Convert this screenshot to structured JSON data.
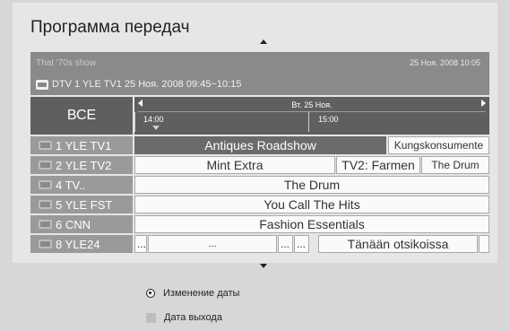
{
  "header": {
    "title": "Программа передач"
  },
  "info": {
    "show": "That '70s show",
    "datetime": "25 Ноя. 2008 10:05",
    "line": "DTV 1 YLE TV1 25 Ноя. 2008 09:45~10:15"
  },
  "timebar": {
    "all_label": "ВСЕ",
    "date": "Вт. 25 Ноя.",
    "time1": "14:00",
    "time2": "15:00"
  },
  "channels": [
    {
      "label": "1  YLE TV1"
    },
    {
      "label": "2  YLE TV2"
    },
    {
      "label": "4  TV.."
    },
    {
      "label": "5  YLE FST"
    },
    {
      "label": "6  CNN"
    },
    {
      "label": "8  YLE24"
    }
  ],
  "programs": {
    "r0": [
      "Antiques Roadshow",
      "Kungskonsumente"
    ],
    "r1": [
      "Mint Extra",
      "TV2: Farmen",
      "The Drum"
    ],
    "r2": [
      "The Drum"
    ],
    "r3": [
      "You Call The Hits"
    ],
    "r4": [
      "Fashion Essentials"
    ],
    "r5": [
      "...",
      "...",
      "...",
      "...",
      "Tänään otsikoissa",
      ""
    ]
  },
  "options": {
    "change_date": "Изменение даты",
    "release_date": "Дата выхода"
  },
  "icons": {
    "channel": "tv-icon",
    "dtv": "dtv-badge-icon"
  },
  "colors": {
    "selected": "#6b6b6b",
    "header_bar": "#5f5f5f",
    "info_bar": "#8a8a8a"
  }
}
